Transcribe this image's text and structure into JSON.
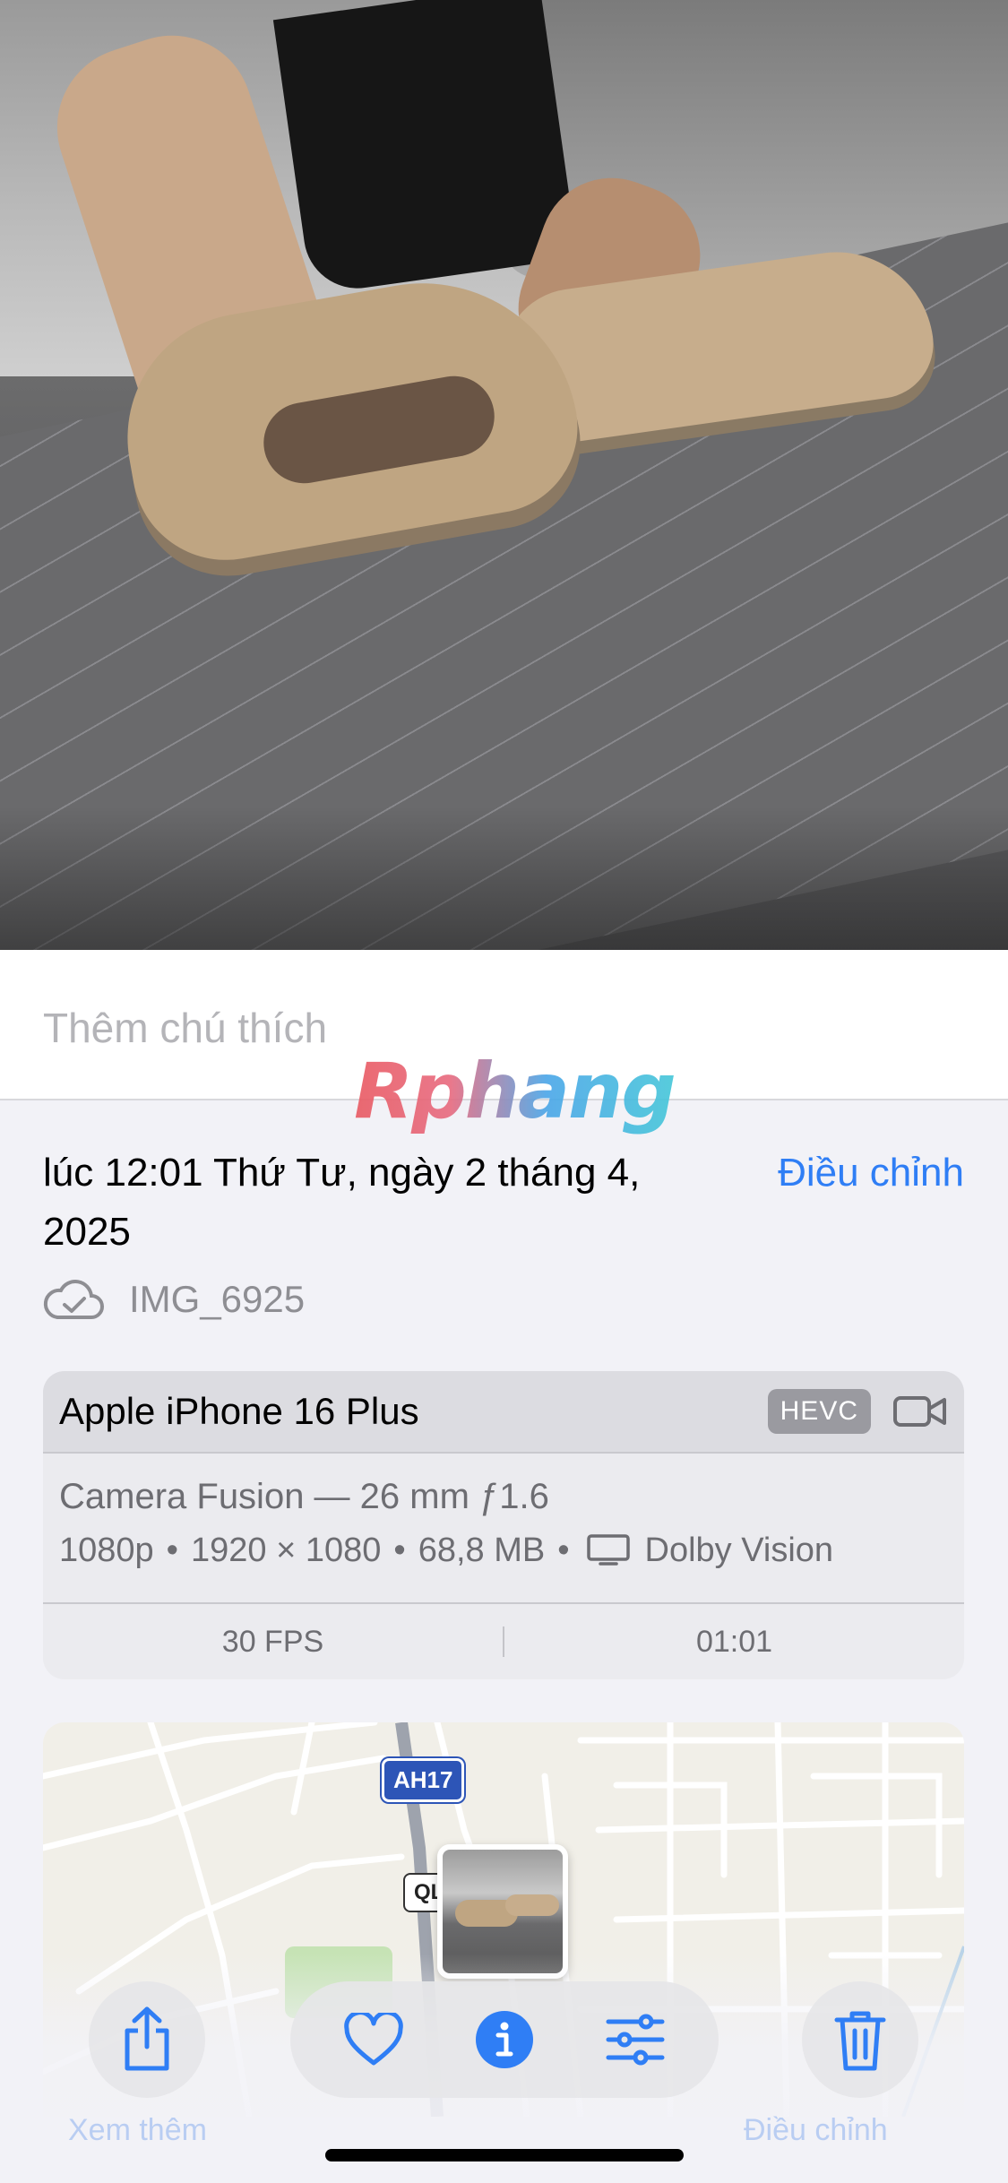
{
  "photo": {
    "description_icon": "photo-preview"
  },
  "caption": {
    "placeholder": "Thêm chú thích"
  },
  "watermark": {
    "text": "Rphang"
  },
  "info": {
    "datetime": "lúc 12:01 Thứ Tư, ngày 2 tháng 4, 2025",
    "adjust_label": "Điều chỉnh",
    "filename": "IMG_6925"
  },
  "device": {
    "model": "Apple iPhone 16 Plus",
    "codec_badge": "HEVC",
    "lens": "Camera Fusion — 26 mm ƒ1.6",
    "resolution": "1080p",
    "dimensions": "1920 × 1080",
    "size": "68,8 MB",
    "hdr": "Dolby Vision",
    "fps": "30 FPS",
    "duration": "01:01",
    "separator": "•"
  },
  "map": {
    "route_badge": "AH17",
    "road_badge": "QL"
  },
  "toolbar": {
    "accent": "#2f7ef5",
    "items": [
      "share-icon",
      "heart-icon",
      "info-icon",
      "adjust-icon",
      "trash-icon"
    ]
  },
  "bottom_hints": {
    "left": "Xem thêm",
    "right": "Điều chỉnh"
  }
}
